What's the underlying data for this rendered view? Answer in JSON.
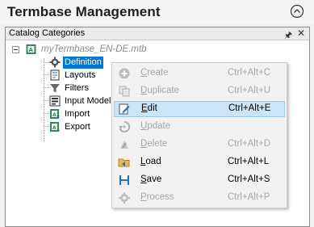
{
  "window": {
    "title": "Termbase Management"
  },
  "panel": {
    "title": "Catalog Categories"
  },
  "tree": {
    "root": {
      "label": "myTermbase_EN-DE.mtb"
    },
    "items": [
      {
        "label": "Definition",
        "icon": "gear-icon",
        "selected": true
      },
      {
        "label": "Layouts",
        "icon": "layout-icon"
      },
      {
        "label": "Filters",
        "icon": "filter-icon"
      },
      {
        "label": "Input Models",
        "icon": "input-model-icon"
      },
      {
        "label": "Import",
        "icon": "import-icon"
      },
      {
        "label": "Export",
        "icon": "export-icon"
      }
    ]
  },
  "context_menu": {
    "items": [
      {
        "label": "Create",
        "mnemonic": "C",
        "rest": "reate",
        "shortcut": "Ctrl+Alt+C",
        "enabled": false,
        "icon": "plus-icon"
      },
      {
        "label": "Duplicate",
        "mnemonic": "D",
        "rest": "uplicate",
        "shortcut": "Ctrl+Alt+U",
        "enabled": false,
        "icon": "duplicate-icon"
      },
      {
        "label": "Edit",
        "mnemonic": "E",
        "rest": "dit",
        "shortcut": "Ctrl+Alt+E",
        "enabled": true,
        "hover": true,
        "icon": "edit-icon"
      },
      {
        "label": "Update",
        "mnemonic": "U",
        "rest": "pdate",
        "shortcut": "",
        "enabled": false,
        "icon": "update-icon"
      },
      {
        "label": "Delete",
        "mnemonic": "D",
        "rest": "elete",
        "shortcut": "Ctrl+Alt+D",
        "enabled": false,
        "icon": "delete-icon"
      },
      {
        "label": "Load",
        "mnemonic": "L",
        "rest": "oad",
        "shortcut": "Ctrl+Alt+L",
        "enabled": true,
        "icon": "folder-icon"
      },
      {
        "label": "Save",
        "mnemonic": "S",
        "rest": "ave",
        "shortcut": "Ctrl+Alt+S",
        "enabled": true,
        "icon": "save-icon"
      },
      {
        "label": "Process",
        "mnemonic": "P",
        "rest": "rocess",
        "shortcut": "Ctrl+Alt+P",
        "enabled": false,
        "icon": "process-icon"
      }
    ]
  },
  "colors": {
    "selection": "#0078d7",
    "menu_hover": "#cce4f7",
    "disabled_text": "#a6a6a6"
  }
}
